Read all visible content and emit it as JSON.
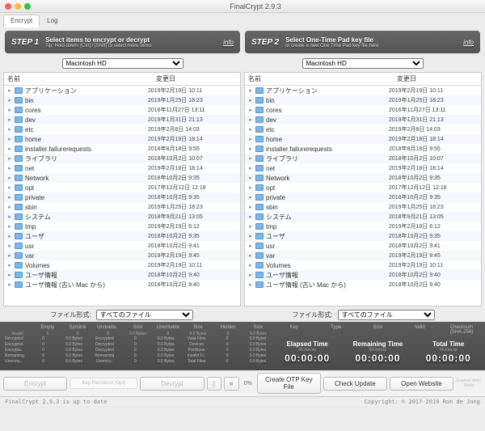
{
  "window": {
    "title": "FinalCrypt 2.9.3"
  },
  "tabs": {
    "encrypt": "Encrypt",
    "log": "Log"
  },
  "steps": {
    "s1": {
      "title": "STEP 1",
      "line1": "Select items to encrypt or decrypt",
      "line2": "Tip: Hold down: [Ctrl] / [Shift] to select more items",
      "info": "info"
    },
    "s2": {
      "title": "STEP 2",
      "line1": "Select One-Time Pad key file",
      "line2": "or create a new One Time Pad key file here",
      "info": "info"
    }
  },
  "drives": {
    "left": "Macintosh HD",
    "right": "Macintosh HD"
  },
  "columns": {
    "name": "名前",
    "modified": "変更日"
  },
  "files": [
    {
      "name": "アプリケーション",
      "date": "2019年2月19日 10:11"
    },
    {
      "name": "bin",
      "date": "2019年1月25日 18:23"
    },
    {
      "name": "cores",
      "date": "2016年11月27日 13:11"
    },
    {
      "name": "dev",
      "date": "2019年1月31日 21:13"
    },
    {
      "name": "etc",
      "date": "2019年2月8日 14:03"
    },
    {
      "name": "home",
      "date": "2019年2月18日 18:14"
    },
    {
      "name": "installer.failurerequests",
      "date": "2018年8月18日 9:55"
    },
    {
      "name": "ライブラリ",
      "date": "2018年10月2日 10:07"
    },
    {
      "name": "net",
      "date": "2019年2月18日 18:14"
    },
    {
      "name": "Network",
      "date": "2018年10月2日 9:35"
    },
    {
      "name": "opt",
      "date": "2017年12月12日 12:18"
    },
    {
      "name": "private",
      "date": "2018年10月2日 9:35"
    },
    {
      "name": "sbin",
      "date": "2019年1月25日 18:23"
    },
    {
      "name": "システム",
      "date": "2018年9月21日 13:05"
    },
    {
      "name": "tmp",
      "date": "2019年2月19日 6:12"
    },
    {
      "name": "ユーザ",
      "date": "2018年10月2日 9:35"
    },
    {
      "name": "usr",
      "date": "2018年10月2日 9:41"
    },
    {
      "name": "var",
      "date": "2019年2月19日 9:45"
    },
    {
      "name": "Volumes",
      "date": "2019年2月19日 10:11"
    },
    {
      "name": "ユーザ情報",
      "date": "2018年10月2日 9:40"
    },
    {
      "name": "ユーザ情報 (古い Mac から)",
      "date": "2018年10月2日 9:40"
    }
  ],
  "filetype": {
    "label": "ファイル形式:",
    "value": "すべてのファイル"
  },
  "stats": {
    "headers_left": [
      "",
      "Empty",
      "Symlink",
      "Unreada..",
      "Size",
      "Unwritable",
      "Size",
      "Hidden",
      "Size"
    ],
    "invalid_row": [
      "Invalid",
      "0",
      "0",
      "0",
      "0.0 Bytes",
      "0",
      "0.0 Bytes",
      "0",
      "0.0 Bytes"
    ],
    "rows_labels": [
      "Decrypted",
      "Encrypted",
      "Encrypta..",
      "Remaining",
      "Unencry.."
    ],
    "rows_cols": [
      [
        "0",
        "0.0 Bytes",
        "Encrypted",
        "0",
        "0.0 Bytes",
        "Valid Files",
        "0",
        "0.0 Bytes"
      ],
      [
        "0",
        "0.0 Bytes",
        "Decrypted",
        "0",
        "0.0 Bytes",
        "Devices",
        "0",
        "0.0 Bytes"
      ],
      [
        "0",
        "0.0 Bytes",
        "Decrypted",
        "0",
        "0.0 Bytes",
        "Partitions",
        "0",
        "0.0 Bytes"
      ],
      [
        "0",
        "0.0 Bytes",
        "Remaining",
        "0",
        "0.0 Bytes",
        "Invalid Fi..",
        "0",
        "0.0 Bytes"
      ],
      [
        "0",
        "0.0 Bytes",
        "Unencry..",
        "0",
        "0.0 Bytes",
        "Total Files",
        "0",
        "0.0 Bytes"
      ]
    ],
    "headers_right": [
      "Key",
      "Type",
      "Size",
      "Valid",
      "Checksum (SHA-256)"
    ],
    "timers": {
      "elapsed": {
        "label": "Elapsed Time",
        "sub": "hh:mm:ss",
        "value": "00:00:00"
      },
      "remaining": {
        "label": "Remaining Time",
        "sub": "hh:mm:ss",
        "value": "00:00:00"
      },
      "total": {
        "label": "Total Time",
        "sub": "hh:mm:ss",
        "value": "00:00:00"
      }
    }
  },
  "buttons": {
    "encrypt": "Encrypt",
    "kpw": "Key Password (Opt)",
    "decrypt": "Decrypt",
    "pause": "||",
    "stop": "■",
    "pct": "0%",
    "create": "Create OTP Key File",
    "check": "Check Update",
    "open": "Open Website",
    "macmode": "Enabled\nMAC Mode"
  },
  "status": {
    "left": "FinalCrypt 2.9.3 is up to date",
    "right": "Copyright: © 2017-2019 Ron de Jong"
  }
}
